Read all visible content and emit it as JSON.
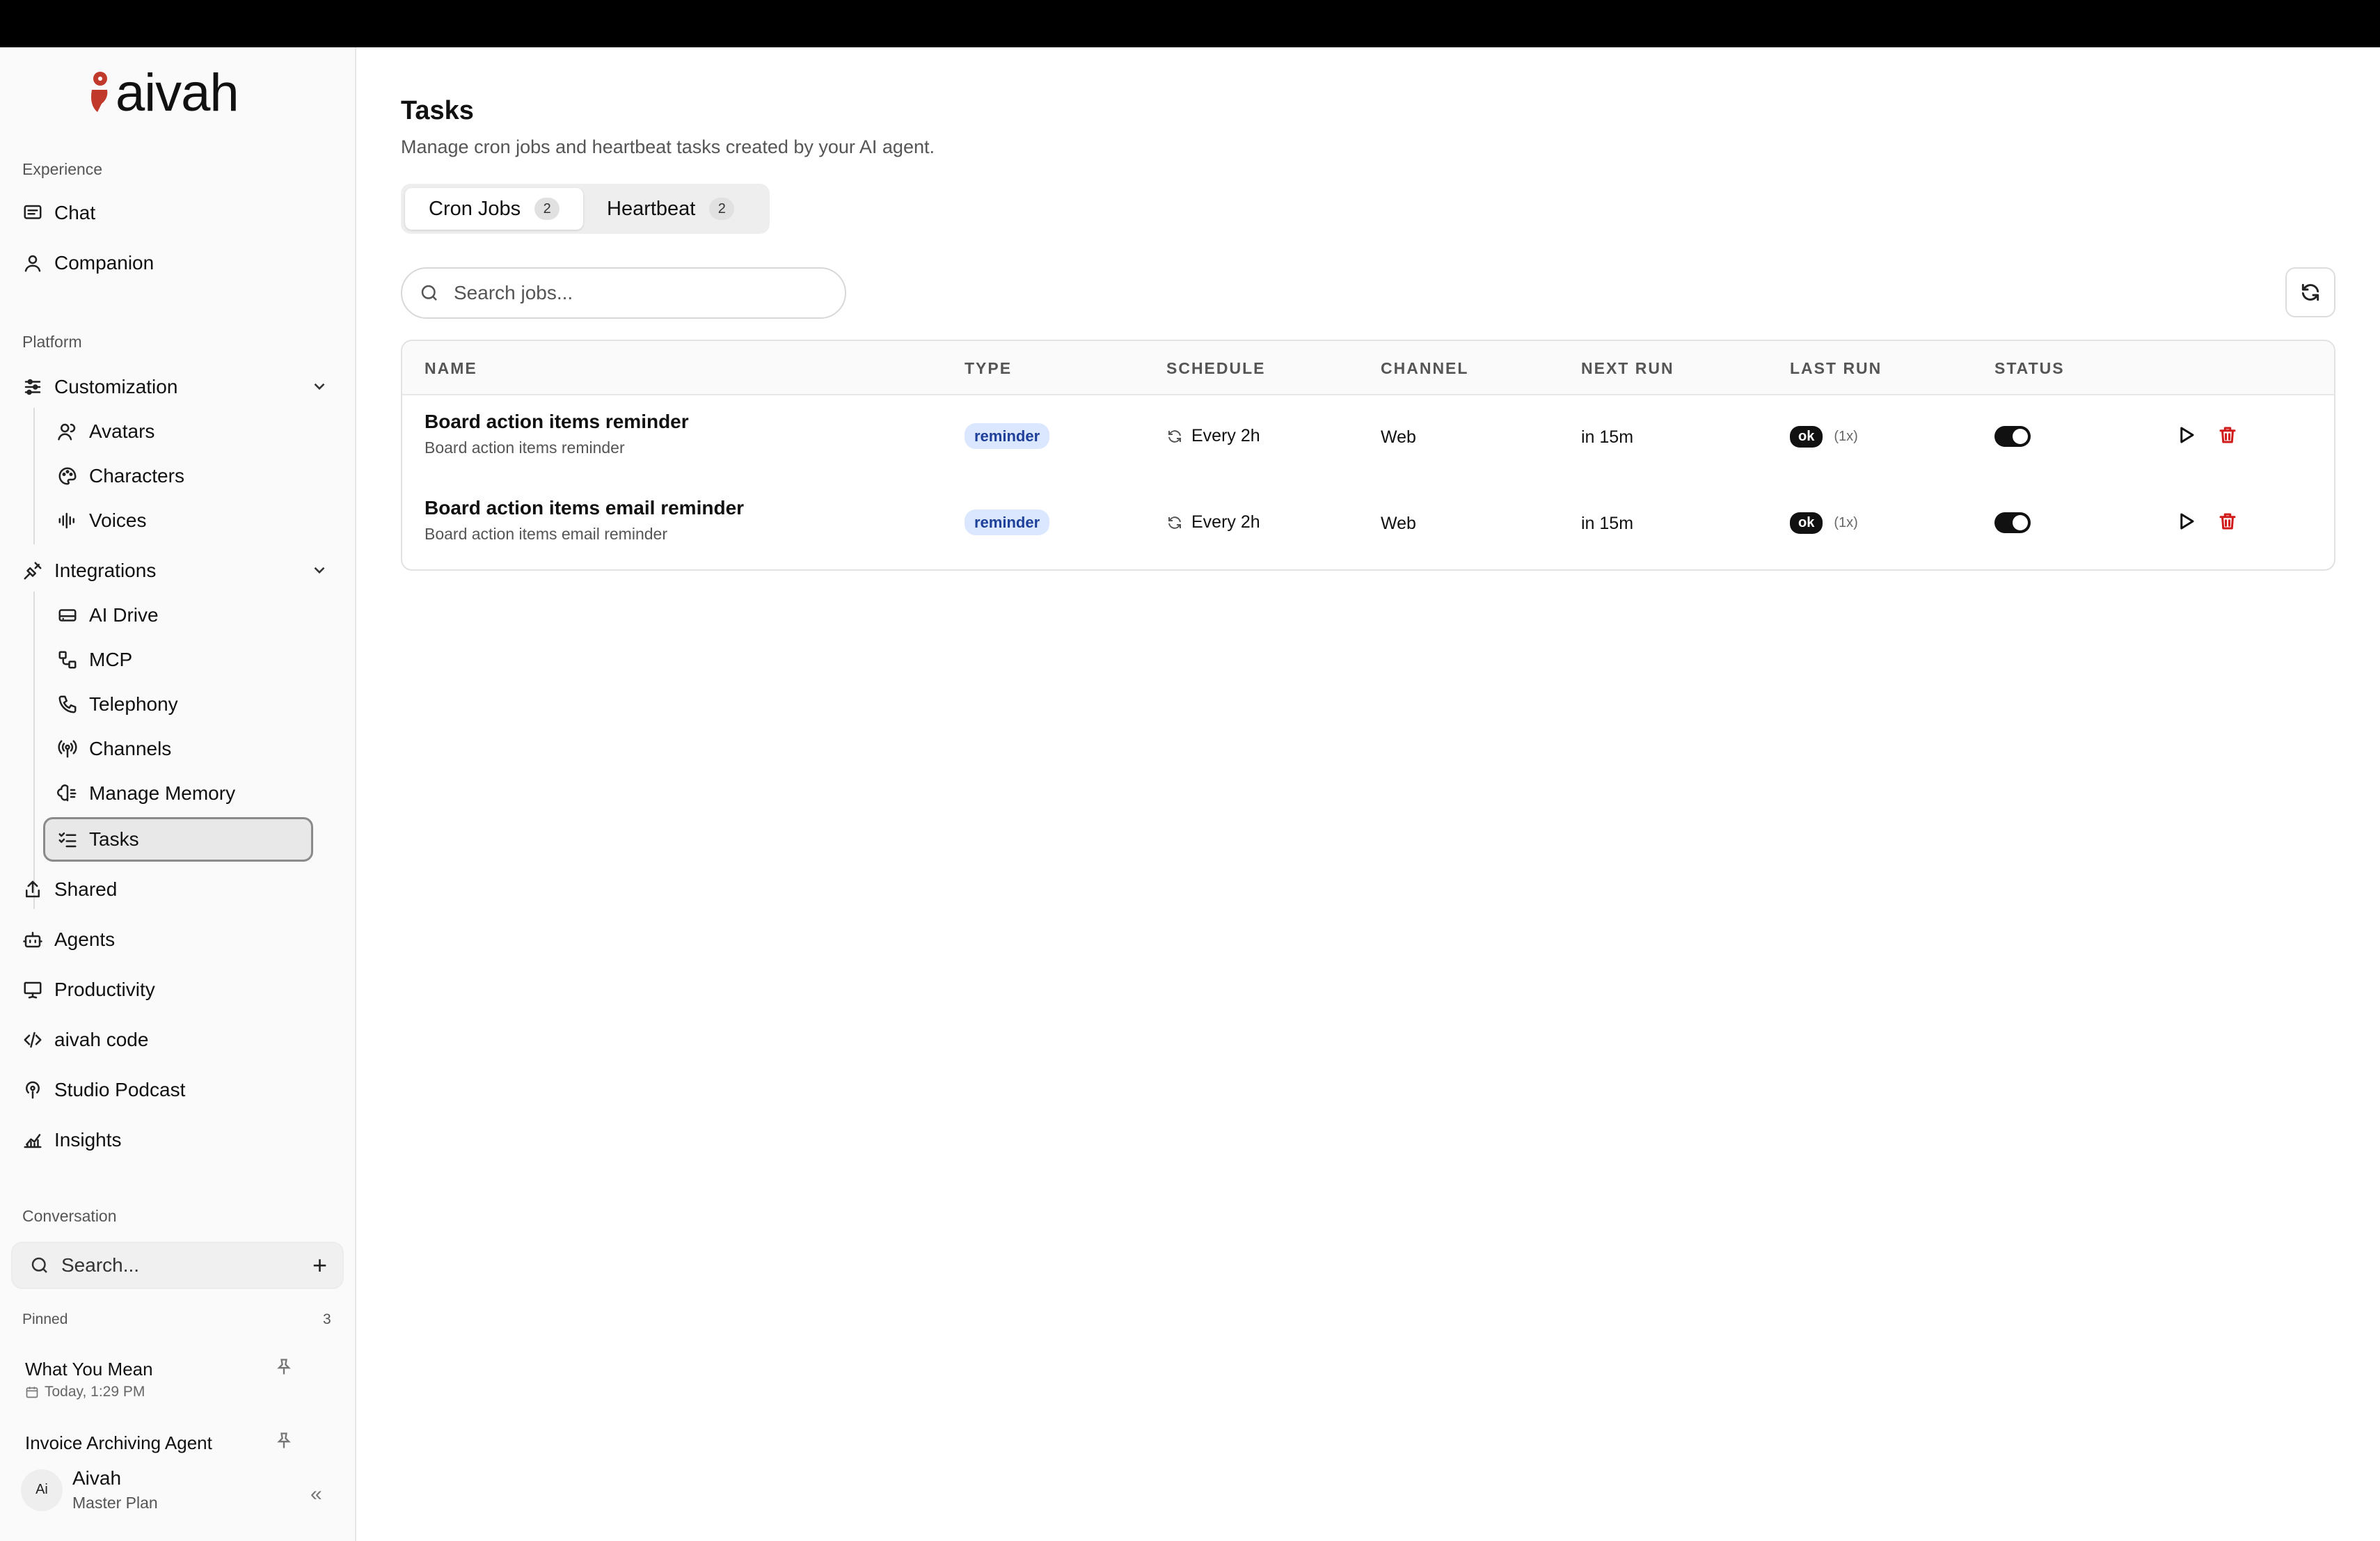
{
  "brand": {
    "name": "aivah"
  },
  "sidebar": {
    "experience_label": "Experience",
    "chat": "Chat",
    "companion": "Companion",
    "platform_label": "Platform",
    "customization": "Customization",
    "avatars": "Avatars",
    "characters": "Characters",
    "voices": "Voices",
    "integrations": "Integrations",
    "ai_drive": "AI Drive",
    "mcp": "MCP",
    "telephony": "Telephony",
    "channels": "Channels",
    "manage_memory": "Manage Memory",
    "tasks": "Tasks",
    "shared": "Shared",
    "agents": "Agents",
    "productivity": "Productivity",
    "aivah_code": "aivah code",
    "studio_podcast": "Studio Podcast",
    "insights": "Insights",
    "conversation_label": "Conversation",
    "search_placeholder": "Search...",
    "pinned_label": "Pinned",
    "pinned_count": "3",
    "pinned": [
      {
        "title": "What You Mean",
        "meta": "Today, 1:29 PM"
      },
      {
        "title": "Invoice Archiving Agent"
      }
    ],
    "user": {
      "initials": "Ai",
      "name": "Aivah",
      "plan": "Master Plan"
    }
  },
  "main": {
    "title": "Tasks",
    "subtitle": "Manage cron jobs and heartbeat tasks created by your AI agent.",
    "tabs": [
      {
        "label": "Cron Jobs",
        "count": "2"
      },
      {
        "label": "Heartbeat",
        "count": "2"
      }
    ],
    "search_placeholder": "Search jobs...",
    "table": {
      "headers": [
        "NAME",
        "TYPE",
        "SCHEDULE",
        "CHANNEL",
        "NEXT RUN",
        "LAST RUN",
        "STATUS"
      ],
      "rows": [
        {
          "name": "Board action items reminder",
          "desc": "Board action items reminder",
          "type": "reminder",
          "schedule": "Every 2h",
          "channel": "Web",
          "next_run": "in 15m",
          "last_run": "ok",
          "last_run_count": "(1x)",
          "enabled": true
        },
        {
          "name": "Board action items email reminder",
          "desc": "Board action items email reminder",
          "type": "reminder",
          "schedule": "Every 2h",
          "channel": "Web",
          "next_run": "in 15m",
          "last_run": "ok",
          "last_run_count": "(1x)",
          "enabled": true
        }
      ]
    }
  },
  "colors": {
    "accent_dark": "#111111",
    "reminder_bg": "#dbe7ff",
    "reminder_text": "#1e3f9a",
    "delete_red": "#d11a1a",
    "logo_red": "#c0392b"
  }
}
